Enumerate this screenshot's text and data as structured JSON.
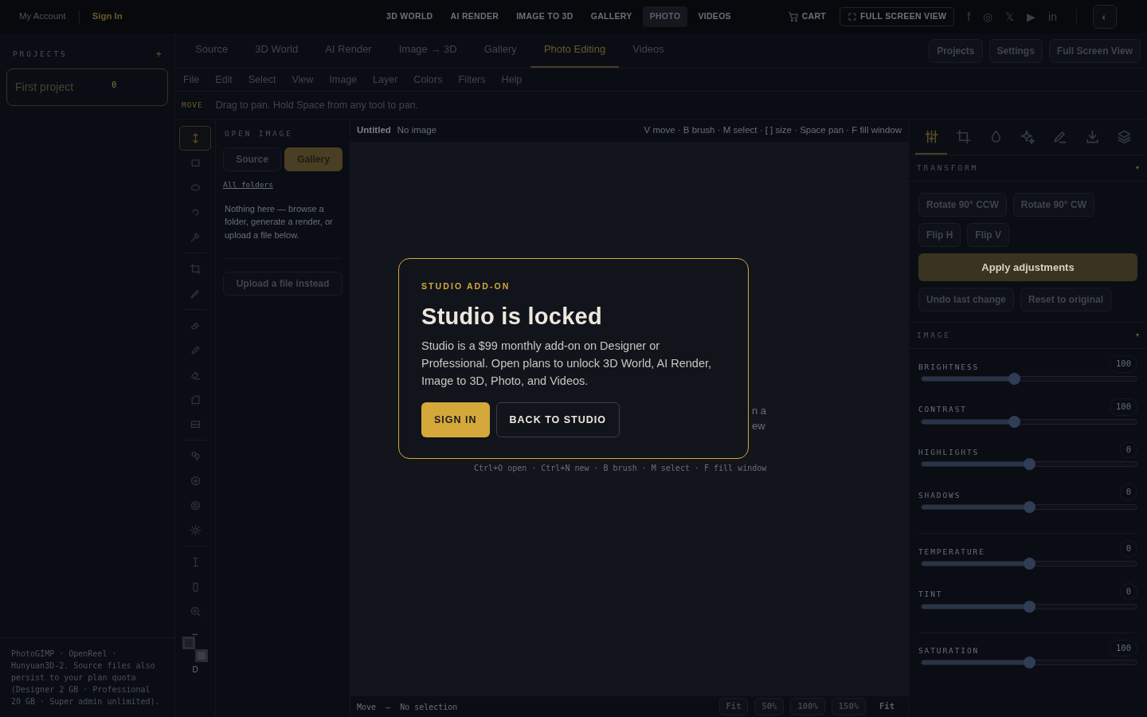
{
  "topbar": {
    "account": "My Account",
    "sign_in": "Sign In",
    "nav": [
      {
        "label": "3D WORLD",
        "selected": false
      },
      {
        "label": "AI RENDER",
        "selected": false
      },
      {
        "label": "IMAGE TO 3D",
        "selected": false
      },
      {
        "label": "GALLERY",
        "selected": false
      },
      {
        "label": "PHOTO",
        "selected": true
      },
      {
        "label": "VIDEOS",
        "selected": false
      }
    ],
    "cart": "CART",
    "fullscreen": "FULL SCREEN VIEW",
    "social": [
      "f",
      "◎",
      "𝕏",
      "▶",
      "in"
    ],
    "theme_toggle": "◐"
  },
  "sidebar": {
    "title": "PROJECTS",
    "add": "+",
    "projects": [
      {
        "name": "First project",
        "count": "0",
        "selected": true
      }
    ],
    "footer": "PhotoGIMP · OpenReel · Hunyuan3D-2. Source files also persist to your plan quota (Designer 2 GB · Professional 20 GB · Super admin unlimited)."
  },
  "tabs": [
    {
      "label": "Source",
      "selected": false
    },
    {
      "label": "3D World",
      "selected": false
    },
    {
      "label": "AI Render",
      "selected": false
    },
    {
      "label": "Image → 3D",
      "selected": false
    },
    {
      "label": "Gallery",
      "selected": false
    },
    {
      "label": "Photo Editing",
      "selected": true
    },
    {
      "label": "Videos",
      "selected": false
    }
  ],
  "tab_actions": [
    "Projects",
    "Settings",
    "Full Screen View"
  ],
  "menu": [
    "File",
    "Edit",
    "Select",
    "View",
    "Image",
    "Layer",
    "Colors",
    "Filters",
    "Help"
  ],
  "tool_hint": {
    "tool": "MOVE",
    "text": "Drag to pan. Hold Space from any tool to pan."
  },
  "tools": [
    [
      {
        "selected": true
      },
      {
        "selected": false
      },
      {
        "selected": false
      },
      {
        "selected": false
      },
      {
        "selected": false
      }
    ],
    [
      {
        "selected": false
      },
      {
        "selected": false
      }
    ],
    [
      {
        "selected": false
      },
      {
        "selected": false
      },
      {
        "selected": false
      },
      {
        "selected": false
      },
      {
        "selected": false
      }
    ],
    [
      {
        "selected": false
      },
      {
        "selected": false
      },
      {
        "selected": false
      },
      {
        "selected": false
      }
    ],
    [
      {
        "selected": false
      },
      {
        "selected": false
      },
      {
        "selected": false
      }
    ]
  ],
  "color_controls": {
    "swap": "↔",
    "reset": "D"
  },
  "open_image": {
    "title": "OPEN IMAGE",
    "sources": [
      {
        "label": "Source",
        "selected": false
      },
      {
        "label": "Gallery",
        "selected": true
      }
    ],
    "link": "All folders",
    "empty": "Nothing here — browse a folder, generate a render, or upload a file below.",
    "upload": "Upload a file instead"
  },
  "canvas": {
    "title": "Untitled",
    "status": "No image",
    "shortcuts": "V move · B brush · M select · [ ] size · Space pan · F fill window",
    "fragments": [
      "n a",
      "ew"
    ],
    "hint": "Ctrl+O open · Ctrl+N new · B brush · M select · F fill window",
    "footer": {
      "tool": "Move",
      "dash": "—",
      "selection": "No selection"
    },
    "zoom": [
      {
        "label": "Fit",
        "disabled": false
      },
      {
        "label": "50%",
        "disabled": false
      },
      {
        "label": "100%",
        "disabled": false
      },
      {
        "label": "150%",
        "disabled": false
      },
      {
        "label": "Fit",
        "disabled": true
      }
    ]
  },
  "panel": {
    "tabs": [
      {
        "selected": true
      },
      {
        "selected": false
      },
      {
        "selected": false
      },
      {
        "selected": false
      },
      {
        "selected": false
      },
      {
        "selected": false
      },
      {
        "selected": false
      }
    ],
    "transform": {
      "title": "TRANSFORM",
      "toggle": "▾",
      "buttons": [
        "Rotate 90° CCW",
        "Rotate 90° CW",
        "Flip H",
        "Flip V"
      ],
      "apply": "Apply adjustments",
      "secondary": [
        "Undo last change",
        "Reset to original"
      ]
    },
    "image": {
      "title": "IMAGE",
      "toggle": "▾",
      "slider_groups": [
        [
          {
            "label": "BRIGHTNESS",
            "value": "100",
            "level": 0.43
          },
          {
            "label": "CONTRAST",
            "value": "100",
            "level": 0.43
          },
          {
            "label": "HIGHLIGHTS",
            "value": "0",
            "level": 0.5
          },
          {
            "label": "SHADOWS",
            "value": "0",
            "level": 0.5
          }
        ],
        [
          {
            "label": "TEMPERATURE",
            "value": "0",
            "level": 0.5
          },
          {
            "label": "TINT",
            "value": "0",
            "level": 0.5
          }
        ],
        [
          {
            "label": "SATURATION",
            "value": "100",
            "level": 0.5
          }
        ]
      ]
    }
  },
  "modal": {
    "eyebrow": "STUDIO ADD-ON",
    "title": "Studio is locked",
    "body": "Studio is a $99 monthly add-on on Designer or Professional. Open plans to unlock 3D World, AI Render, Image to 3D, Photo, and Videos.",
    "primary": "SIGN IN",
    "secondary": "BACK TO STUDIO"
  }
}
